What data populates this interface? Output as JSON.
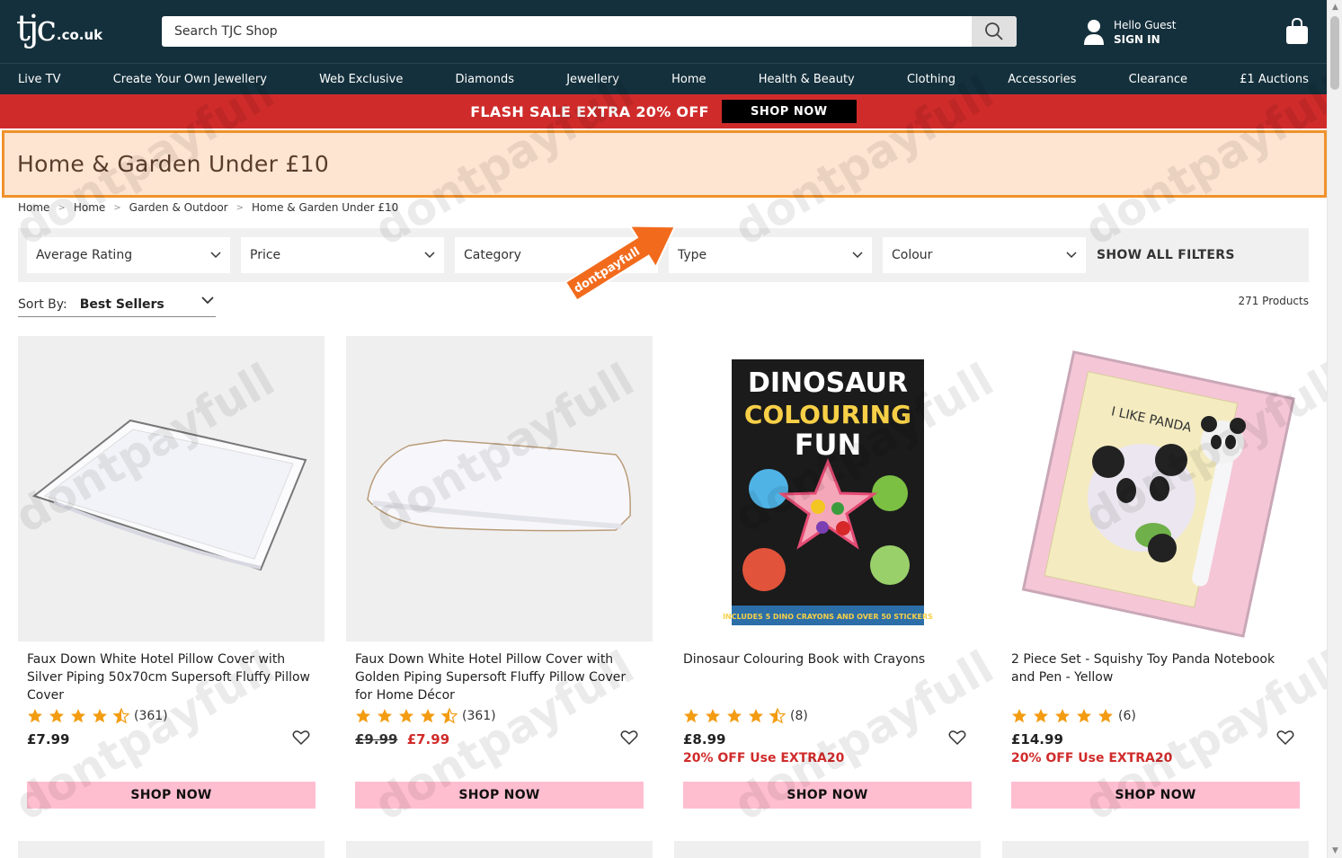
{
  "header": {
    "logo_main": "tjc",
    "logo_suffix": ".co.uk",
    "search_placeholder": "Search TJC Shop",
    "greeting": "Hello Guest",
    "sign_in": "SIGN IN"
  },
  "nav": [
    "Live TV",
    "Create Your Own Jewellery",
    "Web Exclusive",
    "Diamonds",
    "Jewellery",
    "Home",
    "Health & Beauty",
    "Clothing",
    "Accessories",
    "Clearance",
    "£1 Auctions"
  ],
  "flash": {
    "message": "FLASH SALE EXTRA 20% OFF",
    "cta": "SHOP NOW"
  },
  "page_title": "Home & Garden Under £10",
  "breadcrumb": [
    "Home",
    "Home",
    "Garden & Outdoor",
    "Home & Garden Under £10"
  ],
  "filters": [
    "Average Rating",
    "Price",
    "Category",
    "Type",
    "Colour"
  ],
  "show_all_filters": "SHOW ALL FILTERS",
  "sort": {
    "label": "Sort By:",
    "value": "Best Sellers"
  },
  "product_count": "271 Products",
  "watermark": "dontpayfull",
  "products": [
    {
      "title": "Faux Down White Hotel Pillow Cover with Silver Piping 50x70cm Supersoft Fluffy Pillow Cover",
      "rating": 4.5,
      "reviews": "(361)",
      "was": "",
      "price": "£7.99",
      "promo": "",
      "cta": "SHOP NOW"
    },
    {
      "title": "Faux Down White Hotel Pillow Cover with Golden Piping Supersoft Fluffy Pillow Cover for Home Décor",
      "rating": 4.5,
      "reviews": "(361)",
      "was": "£9.99",
      "price": "£7.99",
      "promo": "",
      "cta": "SHOP NOW"
    },
    {
      "title": "Dinosaur Colouring Book with Crayons",
      "rating": 4.5,
      "reviews": "(8)",
      "was": "",
      "price": "£8.99",
      "promo": "20% OFF Use EXTRA20",
      "cta": "SHOP NOW",
      "book_title_1": "DINOSAUR",
      "book_title_2": "COLOURING",
      "book_title_3": "FUN",
      "book_footer": "INCLUDES 5 DINO CRAYONS AND OVER 50 STICKERS"
    },
    {
      "title": "2 Piece Set - Squishy Toy Panda Notebook and Pen - Yellow",
      "rating": 5,
      "reviews": "(6)",
      "was": "",
      "price": "£14.99",
      "promo": "20% OFF Use EXTRA20",
      "cta": "SHOP NOW",
      "notebook_text": "I LIKE PANDA"
    }
  ],
  "colors": {
    "header_bg": "#14303c",
    "flash_bg": "#d02b2b",
    "banner_bg": "#fde5d1",
    "banner_border": "#f0922c",
    "shop_btn": "#ffbed0",
    "star": "#f39c12"
  }
}
